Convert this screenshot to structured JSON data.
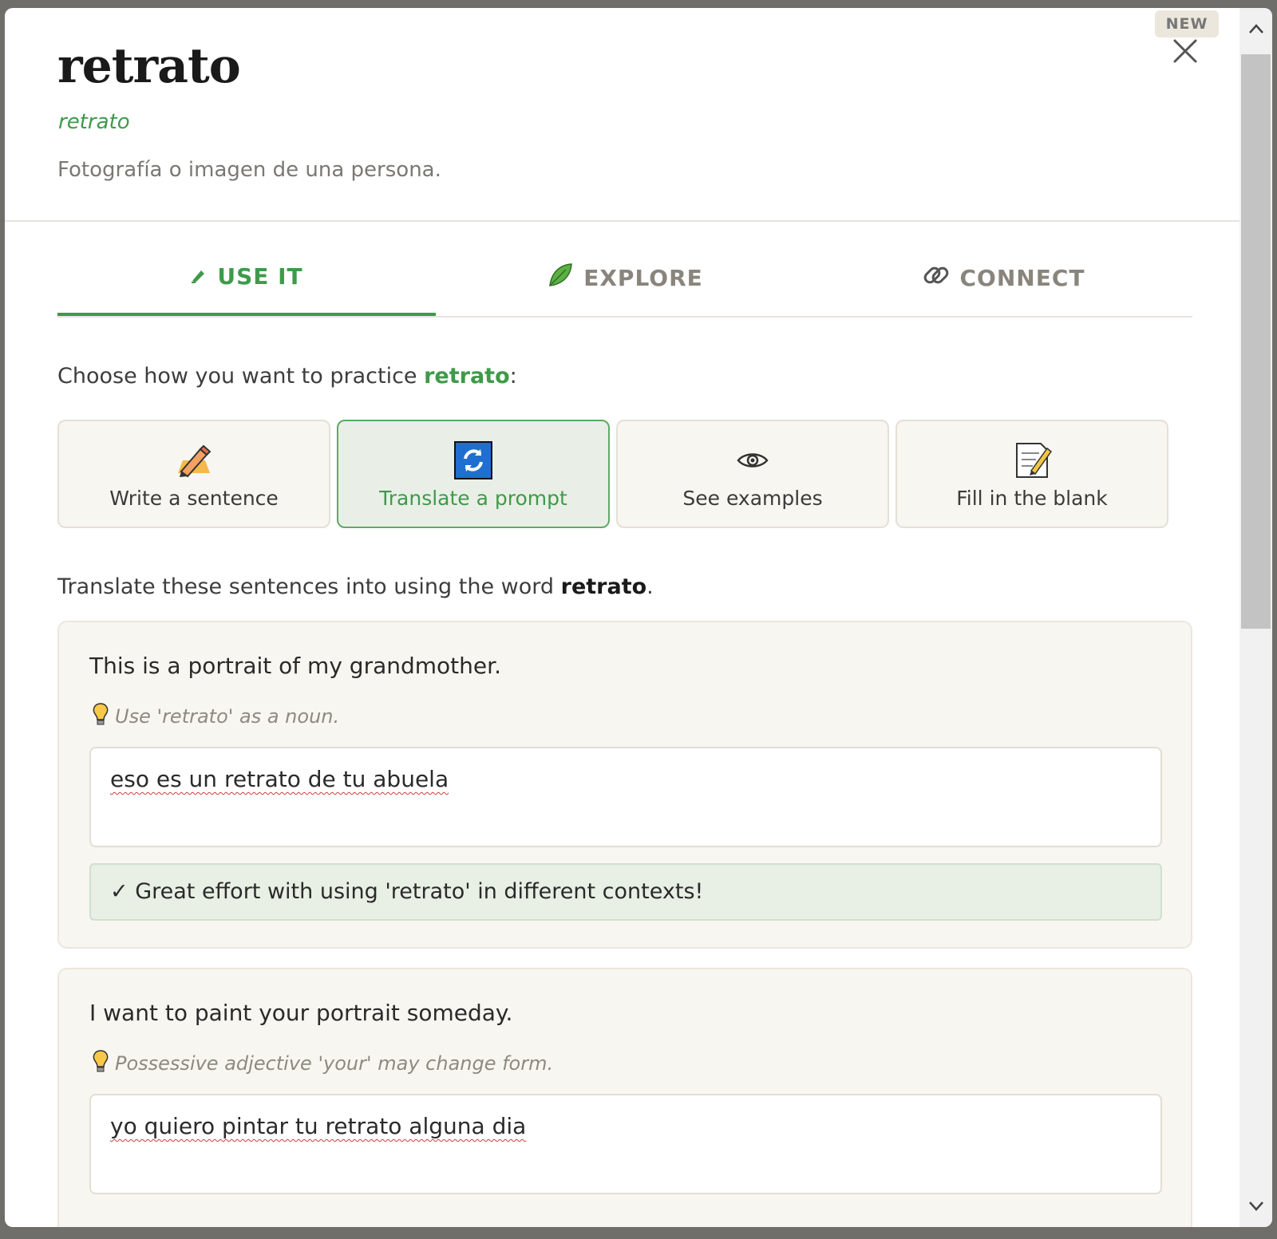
{
  "header": {
    "word": "retrato",
    "pronunciation": "retrato",
    "definition": "Fotografía o imagen de una persona.",
    "badge": "NEW"
  },
  "tabs": [
    {
      "label": "USE IT",
      "icon": "pen-writing-icon",
      "active": true
    },
    {
      "label": "EXPLORE",
      "icon": "leaf-icon",
      "active": false
    },
    {
      "label": "CONNECT",
      "icon": "link-icon",
      "active": false
    }
  ],
  "practice": {
    "prompt_prefix": "Choose how you want to practice ",
    "prompt_word": "retrato",
    "prompt_suffix": ":",
    "modes": [
      {
        "label": "Write a sentence",
        "icon": "pencil-icon",
        "selected": false
      },
      {
        "label": "Translate a prompt",
        "icon": "refresh-icon",
        "selected": true
      },
      {
        "label": "See examples",
        "icon": "eye-icon",
        "selected": false
      },
      {
        "label": "Fill in the blank",
        "icon": "memo-icon",
        "selected": false
      }
    ]
  },
  "instruction": {
    "prefix": "Translate these sentences into  using the word ",
    "word": "retrato",
    "suffix": "."
  },
  "exercises": [
    {
      "sentence": "This is a portrait of my grandmother.",
      "hint": "Use 'retrato' as a noun.",
      "answer": "eso es un retrato de tu abuela",
      "feedback": "✓ Great effort with using 'retrato' in different contexts!"
    },
    {
      "sentence": "I want to paint your portrait someday.",
      "hint": "Possessive adjective 'your' may change form.",
      "answer": "yo quiero pintar tu retrato alguna dia"
    }
  ],
  "colors": {
    "accent": "#3f9a4a",
    "card_bg": "#f8f6f0",
    "selected_bg": "#e9efe6"
  }
}
